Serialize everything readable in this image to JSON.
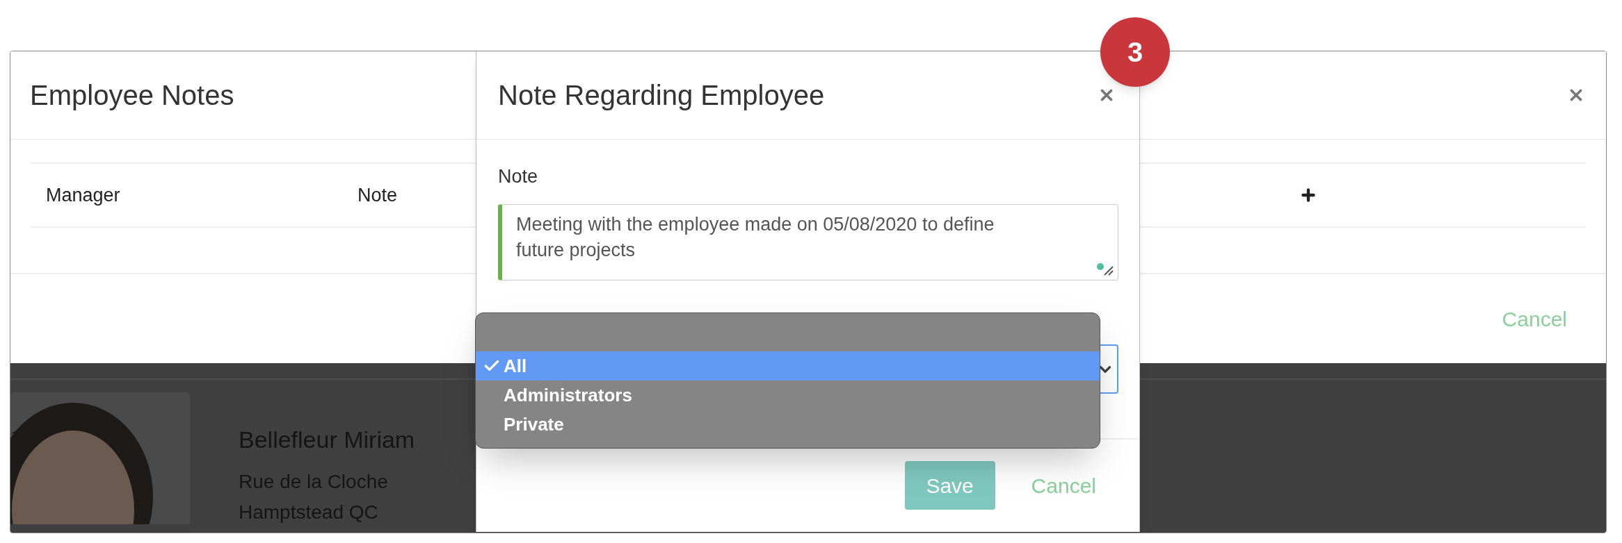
{
  "notes_dialog": {
    "title": "Employee Notes",
    "columns": [
      "Manager",
      "Note"
    ],
    "footer_button": "Cancel"
  },
  "employee_card": {
    "photo": {
      "kind": "picture"
    },
    "name": "Bellefleur Miriam",
    "address_lines": [
      "Rue de la Cloche",
      "Hamptstead QC"
    ]
  },
  "note_dialog": {
    "title": "Note Regarding Employee",
    "note_label": "Note",
    "note_value": "Meeting with the employee made on 05/08/2020 to define future projects",
    "visibility_menu": [
      {
        "label": "All",
        "selected": true
      },
      {
        "label": "Administrators",
        "selected": false
      },
      {
        "label": "Private",
        "selected": false
      }
    ],
    "buttons": [
      {
        "label": "Save",
        "kind": "primary"
      },
      {
        "label": "Cancel",
        "kind": "link"
      }
    ]
  },
  "step_badge": "3"
}
